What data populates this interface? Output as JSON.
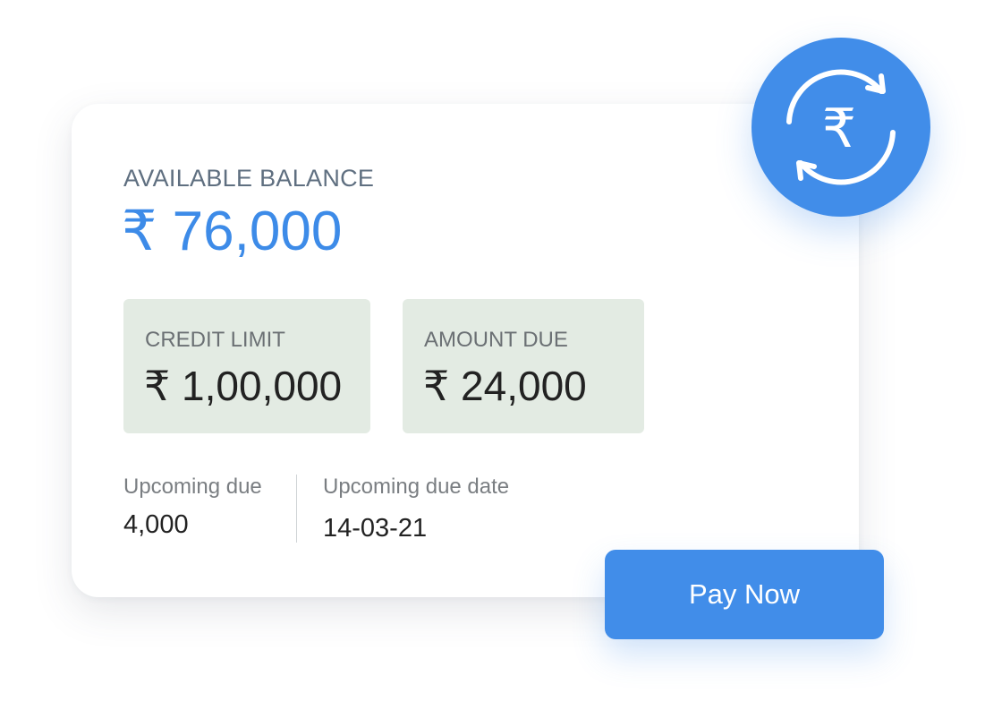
{
  "balance": {
    "label": "AVAILABLE BALANCE",
    "value": "₹ 76,000"
  },
  "stats": {
    "credit_limit": {
      "label": "CREDIT LIMIT",
      "value": "₹ 1,00,000"
    },
    "amount_due": {
      "label": "AMOUNT DUE",
      "value": "₹ 24,000"
    }
  },
  "upcoming": {
    "due": {
      "label": "Upcoming due",
      "value": "4,000"
    },
    "due_date": {
      "label": "Upcoming due date",
      "value": "14-03-21"
    }
  },
  "actions": {
    "pay_label": "Pay Now"
  },
  "icon": {
    "name": "rupee-refresh-icon",
    "glyph": "₹"
  },
  "colors": {
    "accent": "#418de9",
    "balance_text": "#3d8be8",
    "stat_box_bg": "#e3ebe3"
  }
}
